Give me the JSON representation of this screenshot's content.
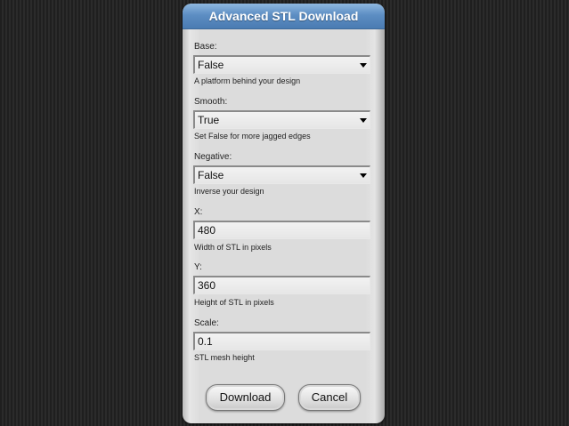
{
  "dialog": {
    "title": "Advanced STL Download"
  },
  "fields": {
    "base": {
      "label": "Base:",
      "value": "False",
      "help": "A platform behind your design"
    },
    "smooth": {
      "label": "Smooth:",
      "value": "True",
      "help": "Set False for more jagged edges"
    },
    "negative": {
      "label": "Negative:",
      "value": "False",
      "help": "Inverse your design"
    },
    "x": {
      "label": "X:",
      "value": "480",
      "help": "Width of STL in pixels"
    },
    "y": {
      "label": "Y:",
      "value": "360",
      "help": "Height of STL in pixels"
    },
    "scale": {
      "label": "Scale:",
      "value": "0.1",
      "help": "STL mesh height"
    }
  },
  "buttons": {
    "download": "Download",
    "cancel": "Cancel"
  },
  "colors": {
    "title_bar": "#5d8ec3",
    "dialog_bg": "#dcdcdc",
    "page_bg": "#222222"
  },
  "icons": {
    "dropdown": "chevron-down-icon"
  }
}
